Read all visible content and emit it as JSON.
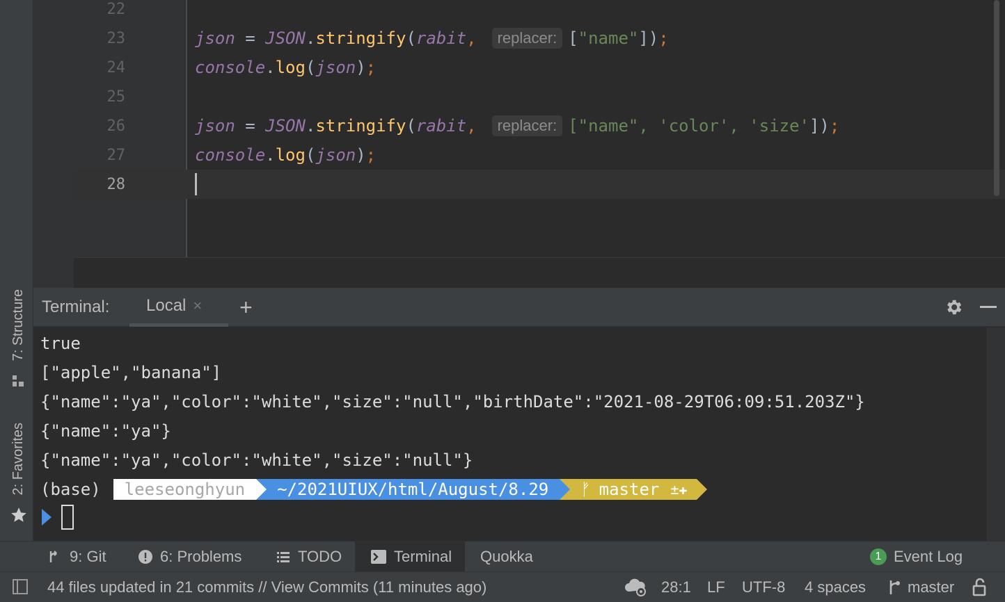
{
  "editor": {
    "lines": [
      {
        "num": "22"
      },
      {
        "num": "23",
        "var": "json",
        "eq": " = ",
        "obj": "JSON",
        "dot": ".",
        "fn": "stringify",
        "open": "(",
        "arg": "rabit",
        "comma": ",",
        "hint": "replacer:",
        "array": [
          "\"name\""
        ],
        "close": "])",
        "semi": ";"
      },
      {
        "num": "24",
        "obj": "console",
        "dot": ".",
        "fn": "log",
        "open": "(",
        "arg": "json",
        "close": ")",
        "semi": ";"
      },
      {
        "num": "25"
      },
      {
        "num": "26",
        "var": "json",
        "eq": " = ",
        "obj": "JSON",
        "dot": ".",
        "fn": "stringify",
        "open": "(",
        "arg": "rabit",
        "comma": ",",
        "hint": "replacer:",
        "array_full": "[\"name\", 'color', 'size'",
        "close": "])",
        "semi": ";"
      },
      {
        "num": "27",
        "obj": "console",
        "dot": ".",
        "fn": "log",
        "open": "(",
        "arg": "json",
        "close": ")",
        "semi": ";"
      },
      {
        "num": "28"
      }
    ],
    "current_line": "28"
  },
  "side_tabs": {
    "structure": "7: Structure",
    "favorites": "2: Favorites"
  },
  "terminal": {
    "label": "Terminal:",
    "tab": "Local",
    "close": "×",
    "add": "+",
    "output": [
      "true",
      "[\"apple\",\"banana\"]",
      "{\"name\":\"ya\",\"color\":\"white\",\"size\":\"null\",\"birthDate\":\"2021-08-29T06:09:51.203Z\"}",
      "{\"name\":\"ya\"}",
      "{\"name\":\"ya\",\"color\":\"white\",\"size\":\"null\"}"
    ],
    "prompt": {
      "env": "(base)",
      "user": "leeseonghyun",
      "path": "~/2021UIUX/html/August/8.29",
      "branch_icon": "ᚠ",
      "branch": "master",
      "git_status": "±✚"
    }
  },
  "toolbar": {
    "git": "9: Git",
    "problems": "6: Problems",
    "todo": "TODO",
    "terminal": "Terminal",
    "quokka": "Quokka",
    "event_log_count": "1",
    "event_log": "Event Log"
  },
  "status": {
    "message": "44 files updated in 21 commits // View Commits (11 minutes ago)",
    "position": "28:1",
    "line_sep": "LF",
    "encoding": "UTF-8",
    "indent": "4 spaces",
    "branch": "master"
  },
  "colors": {
    "accent_blue": "#4a90e2",
    "git_yellow": "#d3b83f",
    "badge_green": "#499c54"
  }
}
